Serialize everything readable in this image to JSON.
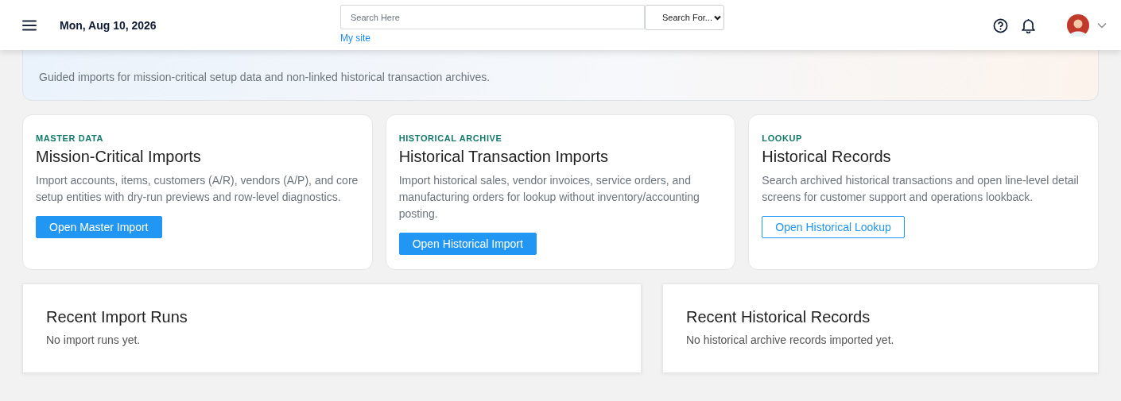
{
  "header": {
    "date": "Mon, Aug 10, 2026",
    "search": {
      "placeholder": "Search Here"
    },
    "search_scope": "Search For...",
    "site_link": "My site"
  },
  "hero": {
    "subtitle": "Guided imports for mission-critical setup data and non-linked historical transaction archives."
  },
  "cards": [
    {
      "eyebrow": "MASTER DATA",
      "title": "Mission-Critical Imports",
      "description": "Import accounts, items, customers (A/R), vendors (A/P), and core setup entities with dry-run previews and row-level diagnostics.",
      "button": {
        "label": "Open Master Import",
        "kind": "primary"
      }
    },
    {
      "eyebrow": "HISTORICAL ARCHIVE",
      "title": "Historical Transaction Imports",
      "description": "Import historical sales, vendor invoices, service orders, and manufacturing orders for lookup without inventory/accounting posting.",
      "button": {
        "label": "Open Historical Import",
        "kind": "primary"
      }
    },
    {
      "eyebrow": "LOOKUP",
      "title": "Historical Records",
      "description": "Search archived historical transactions and open line-level detail screens for customer support and operations lookback.",
      "button": {
        "label": "Open Historical Lookup",
        "kind": "outline"
      }
    }
  ],
  "panels": [
    {
      "title": "Recent Import Runs",
      "message": "No import runs yet."
    },
    {
      "title": "Recent Historical Records",
      "message": "No historical archive records imported yet."
    }
  ]
}
